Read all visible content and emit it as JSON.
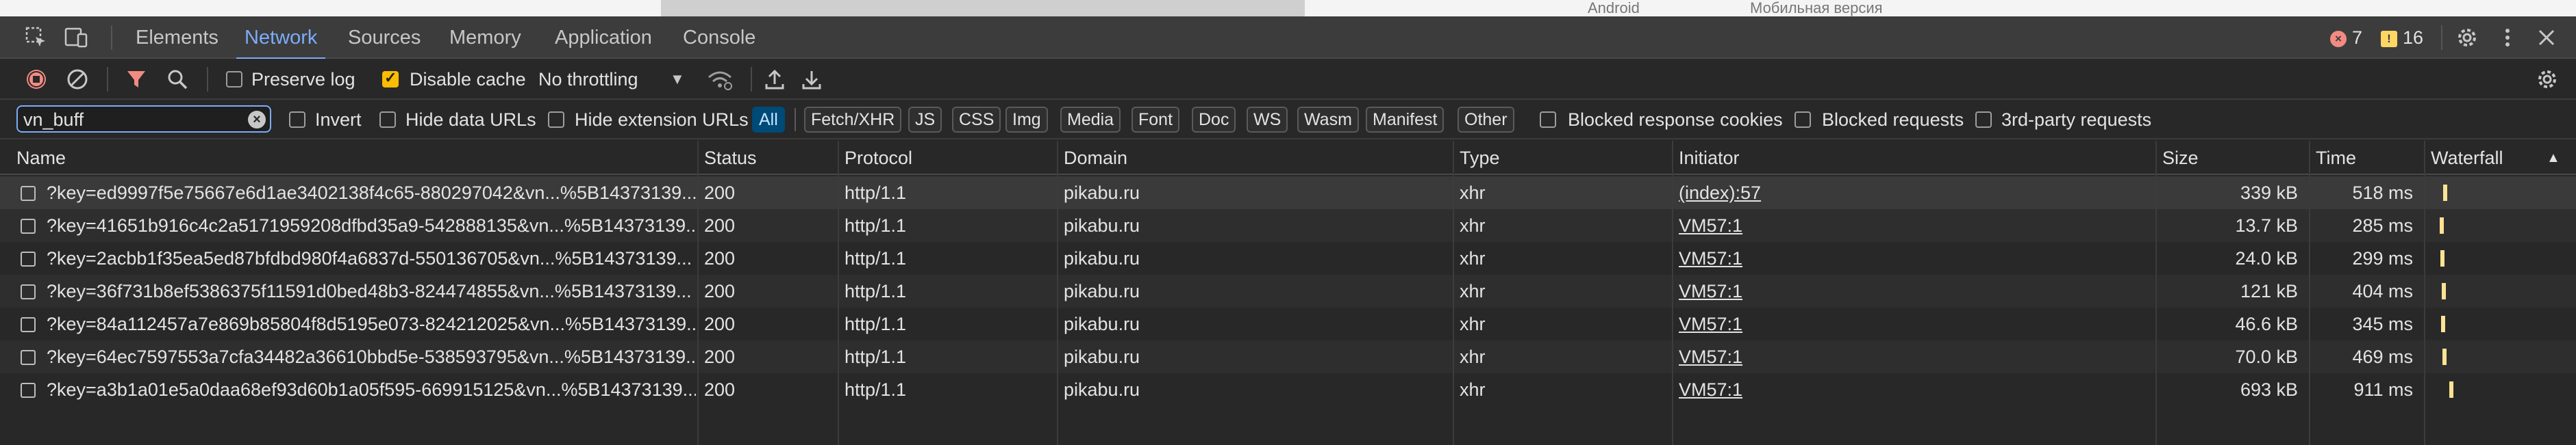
{
  "page_behind": {
    "android_label": "Android",
    "mobile_label": "Мобильная версия"
  },
  "devtools_tabs": [
    {
      "label": "Elements"
    },
    {
      "label": "Network"
    },
    {
      "label": "Sources"
    },
    {
      "label": "Memory"
    },
    {
      "label": "Application"
    },
    {
      "label": "Console"
    }
  ],
  "badges": {
    "errors": "7",
    "warnings": "16",
    "error_glyph": "×",
    "warning_glyph": "!"
  },
  "toolbar": {
    "preserve_log_label": "Preserve log",
    "preserve_log_checked": false,
    "disable_cache_label": "Disable cache",
    "disable_cache_checked": true,
    "throttling_value": "No throttling"
  },
  "filter": {
    "search_value": "vn_buff",
    "invert_label": "Invert",
    "hide_data_urls_label": "Hide data URLs",
    "hide_extension_urls_label": "Hide extension URLs",
    "types": [
      "All",
      "Fetch/XHR",
      "JS",
      "CSS",
      "Img",
      "Media",
      "Font",
      "Doc",
      "WS",
      "Wasm",
      "Manifest",
      "Other"
    ],
    "active_type": "All",
    "blocked_cookies_label": "Blocked response cookies",
    "blocked_requests_label": "Blocked requests",
    "third_party_label": "3rd-party requests"
  },
  "table": {
    "columns": [
      "Name",
      "Status",
      "Protocol",
      "Domain",
      "Type",
      "Initiator",
      "Size",
      "Time",
      "Waterfall"
    ],
    "rows": [
      {
        "name": "?key=ed9997f5e75667e6d1ae3402138f4c65-880297042&vn...%5B14373139...",
        "status": "200",
        "protocol": "http/1.1",
        "domain": "pikabu.ru",
        "type": "xhr",
        "initiator": "(index):57",
        "size": "339 kB",
        "time": "518 ms",
        "waterfall_ms": 518
      },
      {
        "name": "?key=41651b916c4c2a5171959208dfbd35a9-542888135&vn...%5B14373139...",
        "status": "200",
        "protocol": "http/1.1",
        "domain": "pikabu.ru",
        "type": "xhr",
        "initiator": "VM57:1",
        "size": "13.7 kB",
        "time": "285 ms",
        "waterfall_ms": 285
      },
      {
        "name": "?key=2acbb1f35ea5ed87bfdbd980f4a6837d-550136705&vn...%5B14373139...",
        "status": "200",
        "protocol": "http/1.1",
        "domain": "pikabu.ru",
        "type": "xhr",
        "initiator": "VM57:1",
        "size": "24.0 kB",
        "time": "299 ms",
        "waterfall_ms": 299
      },
      {
        "name": "?key=36f731b8ef5386375f11591d0bed48b3-824474855&vn...%5B14373139...",
        "status": "200",
        "protocol": "http/1.1",
        "domain": "pikabu.ru",
        "type": "xhr",
        "initiator": "VM57:1",
        "size": "121 kB",
        "time": "404 ms",
        "waterfall_ms": 404
      },
      {
        "name": "?key=84a112457a7e869b85804f8d5195e073-824212025&vn...%5B14373139...",
        "status": "200",
        "protocol": "http/1.1",
        "domain": "pikabu.ru",
        "type": "xhr",
        "initiator": "VM57:1",
        "size": "46.6 kB",
        "time": "345 ms",
        "waterfall_ms": 345
      },
      {
        "name": "?key=64ec7597553a7cfa34482a36610bbd5e-538593795&vn...%5B14373139...",
        "status": "200",
        "protocol": "http/1.1",
        "domain": "pikabu.ru",
        "type": "xhr",
        "initiator": "VM57:1",
        "size": "70.0 kB",
        "time": "469 ms",
        "waterfall_ms": 469
      },
      {
        "name": "?key=a3b1a01e5a0daa68ef93d60b1a05f595-669915125&vn...%5B14373139...",
        "status": "200",
        "protocol": "http/1.1",
        "domain": "pikabu.ru",
        "type": "xhr",
        "initiator": "VM57:1",
        "size": "693 kB",
        "time": "911 ms",
        "waterfall_ms": 911
      }
    ]
  },
  "colors": {
    "accent": "#7cacf8",
    "warning_yellow": "#fbbc04",
    "error_red": "#f28b82",
    "record_red": "#f28b82",
    "filter_red": "#f28b82",
    "chip_active_bg": "#004a77",
    "waterfall_bar": "#fde293"
  }
}
